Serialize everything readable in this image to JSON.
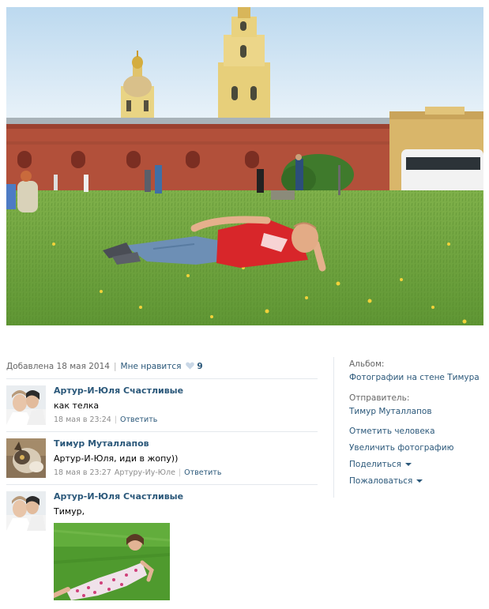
{
  "photo": {
    "alt": ""
  },
  "info": {
    "added": "Добавлена 18 мая 2014",
    "like_label": "Мне нравится",
    "like_count": "9"
  },
  "comments": [
    {
      "author": "Артур-И-Юля Счастливые",
      "text": "как телка",
      "time": "18 мая в 23:24",
      "reply": "Ответить",
      "addressee": ""
    },
    {
      "author": "Тимур Муталлапов",
      "text": "Артур-И-Юля, иди в жопу))",
      "time": "18 мая в 23:27",
      "addressee": "Артуру-Иу-Юле",
      "reply": "Ответить"
    },
    {
      "author": "Артур-И-Юля Счастливые",
      "text": "Тимур,",
      "time": "",
      "reply": "",
      "addressee": ""
    }
  ],
  "sidebar": {
    "album_label": "Альбом:",
    "album_value": "Фотографии на стене Тимура",
    "sender_label": "Отправитель:",
    "sender_value": "Тимур Муталлапов",
    "actions": {
      "tag_person": "Отметить человека",
      "enlarge": "Увеличить фотографию",
      "share": "Поделиться",
      "report": "Пожаловаться"
    }
  },
  "colors": {
    "link": "#2b587a",
    "muted": "#666666",
    "divider": "#e4e8ed",
    "heart": "#c9d7e6"
  }
}
